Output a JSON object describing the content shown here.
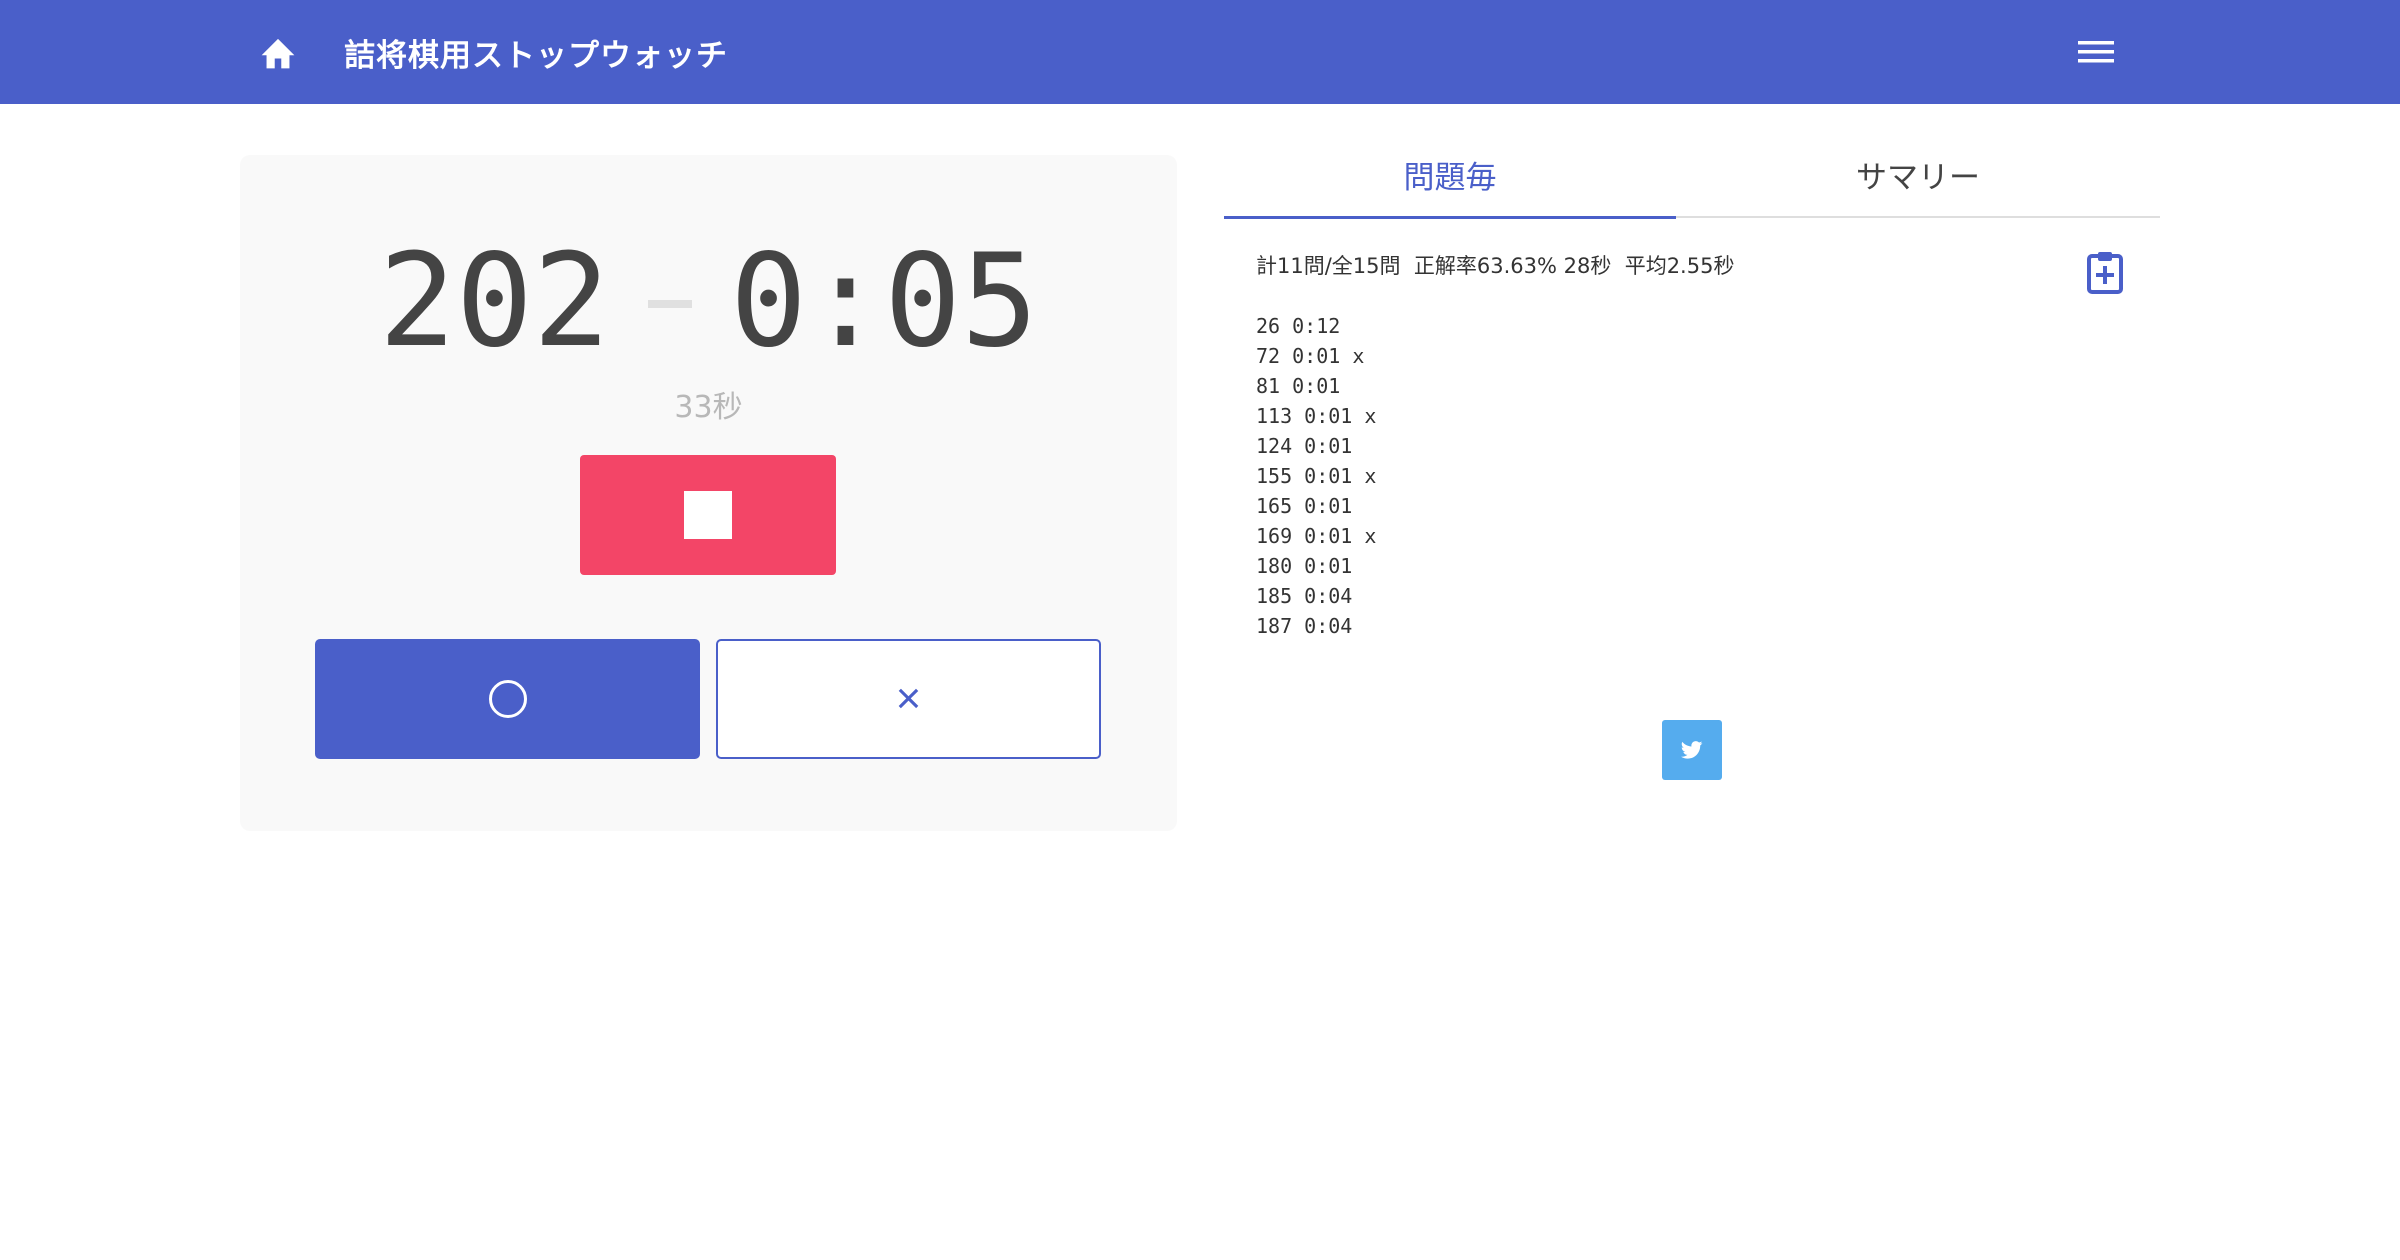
{
  "header": {
    "title": "詰将棋用ストップウォッチ",
    "home_icon": "home-icon",
    "menu_icon": "hamburger-menu-icon",
    "bg_color": "#4a5fc9"
  },
  "stopwatch": {
    "problem_number": "202",
    "elapsed": "0:05",
    "seconds_label": "33秒",
    "stop_icon": "stop-icon",
    "correct_icon": "circle-icon",
    "wrong_label": "×",
    "stop_color": "#f34567",
    "accent_color": "#4a5fc9"
  },
  "results_panel": {
    "tabs": [
      {
        "label": "問題毎",
        "active": true
      },
      {
        "label": "サマリー",
        "active": false
      }
    ],
    "summary": "計11問/全15問  正解率63.63% 28秒  平均2.55秒",
    "clipboard_icon": "clipboard-plus-icon",
    "results": [
      "26 0:12",
      "72 0:01 x",
      "81 0:01",
      "113 0:01 x",
      "124 0:01",
      "155 0:01 x",
      "165 0:01",
      "169 0:01 x",
      "180 0:01",
      "185 0:04",
      "187 0:04"
    ],
    "tweet_icon": "twitter-icon",
    "tweet_color": "#55acee"
  }
}
